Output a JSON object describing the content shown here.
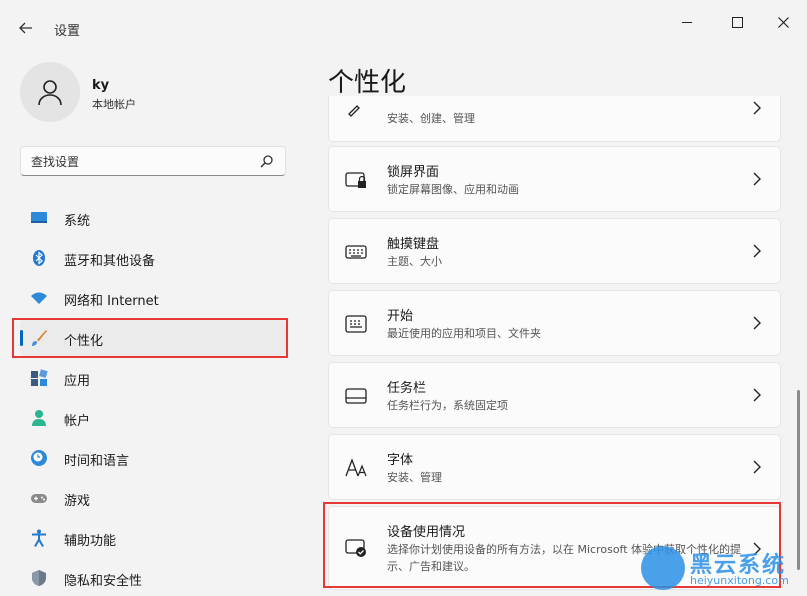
{
  "window": {
    "title": "设置"
  },
  "user": {
    "name": "ky",
    "account_type": "本地帐户"
  },
  "search": {
    "placeholder": "查找设置"
  },
  "sidebar": {
    "items": [
      {
        "label": "系统",
        "icon": "monitor-icon"
      },
      {
        "label": "蓝牙和其他设备",
        "icon": "bluetooth-icon"
      },
      {
        "label": "网络和 Internet",
        "icon": "wifi-icon"
      },
      {
        "label": "个性化",
        "icon": "brush-icon",
        "active": true
      },
      {
        "label": "应用",
        "icon": "apps-icon"
      },
      {
        "label": "帐户",
        "icon": "person-icon"
      },
      {
        "label": "时间和语言",
        "icon": "clock-globe-icon"
      },
      {
        "label": "游戏",
        "icon": "gamepad-icon"
      },
      {
        "label": "辅助功能",
        "icon": "accessibility-icon"
      },
      {
        "label": "隐私和安全性",
        "icon": "shield-icon"
      }
    ]
  },
  "main": {
    "title": "个性化",
    "cards": [
      {
        "title": "",
        "subtitle": "安装、创建、管理",
        "icon": "pen-icon"
      },
      {
        "title": "锁屏界面",
        "subtitle": "锁定屏幕图像、应用和动画",
        "icon": "lock-screen-icon"
      },
      {
        "title": "触摸键盘",
        "subtitle": "主题、大小",
        "icon": "keyboard-icon"
      },
      {
        "title": "开始",
        "subtitle": "最近使用的应用和项目、文件夹",
        "icon": "start-icon"
      },
      {
        "title": "任务栏",
        "subtitle": "任务栏行为，系统固定项",
        "icon": "taskbar-icon"
      },
      {
        "title": "字体",
        "subtitle": "安装、管理",
        "icon": "font-icon"
      },
      {
        "title": "设备使用情况",
        "subtitle": "选择你计划使用设备的所有方法，以在 Microsoft 体验中获取个性化的提示、广告和建议。",
        "icon": "device-usage-icon"
      }
    ]
  },
  "watermark": {
    "brand": "黑云系统",
    "url": "heiyunxitong.com"
  },
  "colors": {
    "accent": "#0067c0",
    "highlight": "#e53935",
    "watermark": "#2b8fe6"
  }
}
